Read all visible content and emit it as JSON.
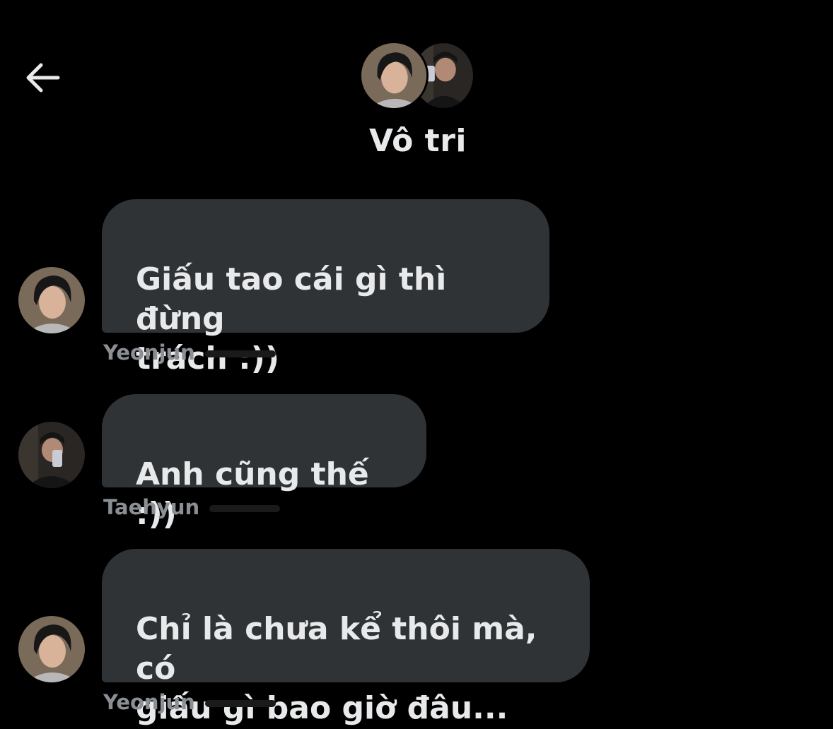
{
  "header": {
    "back_icon": "arrow-left-icon",
    "title": "Vô tri"
  },
  "messages": [
    {
      "text": "Giấu tao cái gì thì đừng\ntrách :))",
      "sender": "Yeonjun"
    },
    {
      "text": "Anh cũng thế :))",
      "sender": "Taehyun"
    },
    {
      "text": "Chỉ là chưa kể thôi mà, có\ngiấu gì bao giờ đâu...",
      "sender": "Yeonjun"
    }
  ],
  "colors": {
    "background": "#000000",
    "bubble": "#2f3336",
    "text": "#e7e9ea",
    "sender": "#8b8f94"
  }
}
